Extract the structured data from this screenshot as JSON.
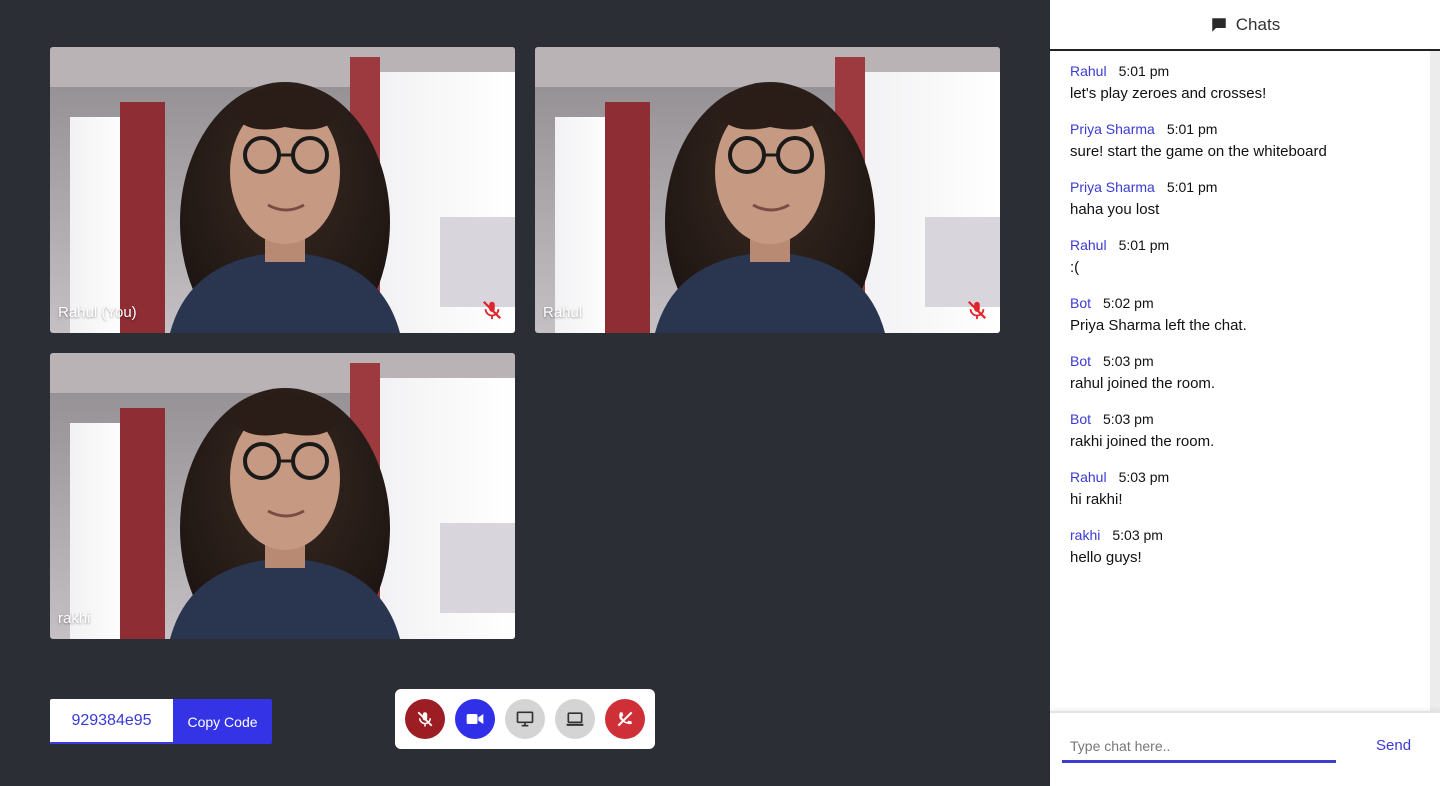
{
  "stage": {
    "tiles": [
      {
        "name": "Rahul (You)",
        "muted": true
      },
      {
        "name": "Rahul",
        "muted": true
      },
      {
        "name": "rakhi",
        "muted": false
      }
    ],
    "room_code": "929384e95",
    "copy_label": "Copy Code"
  },
  "controls": {
    "mic_icon": "mic-off-icon",
    "camera_icon": "video-camera-icon",
    "screen_icon": "monitor-icon",
    "board_icon": "laptop-icon",
    "leave_icon": "phone-hangup-icon"
  },
  "chat": {
    "title": "Chats",
    "messages": [
      {
        "author": "Rahul",
        "time": "5:01 pm",
        "text": "let's play zeroes and crosses!"
      },
      {
        "author": "Priya Sharma",
        "time": "5:01 pm",
        "text": "sure! start the game on the whiteboard"
      },
      {
        "author": "Priya Sharma",
        "time": "5:01 pm",
        "text": "haha you lost"
      },
      {
        "author": "Rahul",
        "time": "5:01 pm",
        "text": ":("
      },
      {
        "author": "Bot",
        "time": "5:02 pm",
        "text": "Priya Sharma left the chat."
      },
      {
        "author": "Bot",
        "time": "5:03 pm",
        "text": "rahul joined the room."
      },
      {
        "author": "Bot",
        "time": "5:03 pm",
        "text": "rakhi joined the room."
      },
      {
        "author": "Rahul",
        "time": "5:03 pm",
        "text": "hi rakhi!"
      },
      {
        "author": "rakhi",
        "time": "5:03 pm",
        "text": "hello guys!"
      }
    ],
    "input_placeholder": "Type chat here..",
    "input_value": "",
    "send_label": "Send"
  },
  "colors": {
    "stage_bg": "#2b2e34",
    "accent": "#3434e6",
    "danger": "#cf2f36",
    "author": "#3a3ad4"
  }
}
